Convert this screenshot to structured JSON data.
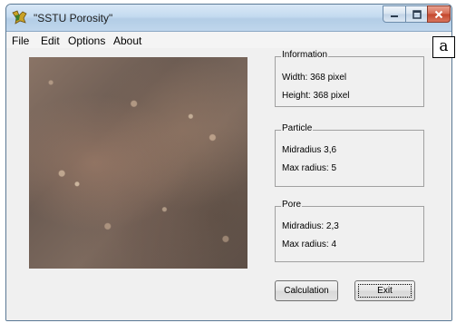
{
  "window": {
    "title": "\"SSTU Porosity\"",
    "icon": "app-icon",
    "controls": {
      "minimize_icon": "minimize-icon",
      "maximize_icon": "maximize-icon",
      "close_icon": "close-icon"
    }
  },
  "menu": {
    "items": [
      {
        "label": "File"
      },
      {
        "label": "Edit"
      },
      {
        "label": "Options"
      },
      {
        "label": "About"
      }
    ]
  },
  "image_panel": {
    "description_icon": "porosity-sample-image"
  },
  "groups": {
    "information": {
      "legend": "Information",
      "width": "Width: 368 pixel",
      "height": "Height: 368 pixel"
    },
    "particle": {
      "legend": "Particle",
      "midradius": "Midradius 3,6",
      "max_radius": "Max radius: 5"
    },
    "pore": {
      "legend": "Pore",
      "midradius": "Midradius:  2,3",
      "max_radius": "Max radius: 4"
    }
  },
  "buttons": {
    "calculation": "Calculation",
    "exit": "Exit"
  },
  "figure_label": "a",
  "colors": {
    "titlebar": "#c4dbf0",
    "close_button": "#c3452b",
    "window_bg": "#f0f0f0"
  }
}
